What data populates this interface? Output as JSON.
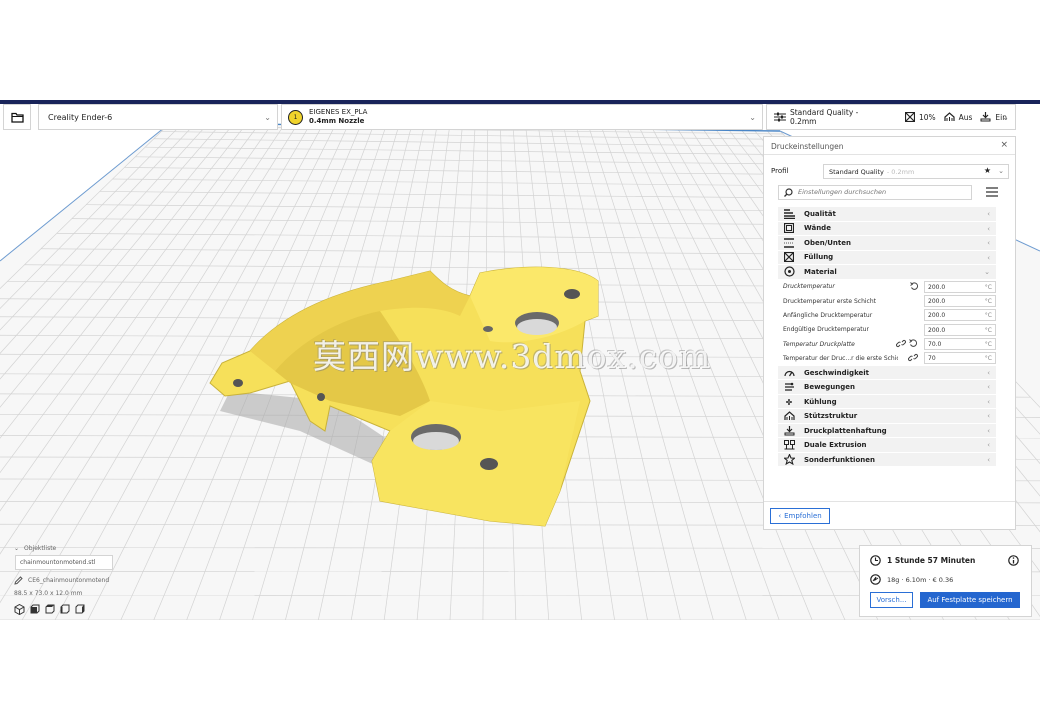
{
  "toolbar": {
    "printer": "Creality Ender-6",
    "material_name": "EIGENES EX_PLA",
    "material_nozzle": "0.4mm Nozzle",
    "quality": "Standard Quality - 0.2mm",
    "infill": "10%",
    "support": "Aus",
    "adhesion": "Ein"
  },
  "panel": {
    "title": "Druckeinstellungen",
    "profile_label": "Profil",
    "profile_value": "Standard Quality",
    "profile_sub": "- 0.2mm",
    "search_placeholder": "Einstellungen durchsuchen",
    "recommended_label": "Empfohlen",
    "categories_top": [
      {
        "label": "Qualität",
        "icon": "quality-icon"
      },
      {
        "label": "Wände",
        "icon": "walls-icon"
      },
      {
        "label": "Oben/Unten",
        "icon": "top-bottom-icon"
      },
      {
        "label": "Füllung",
        "icon": "infill-icon"
      },
      {
        "label": "Material",
        "icon": "material-icon"
      }
    ],
    "material_settings": [
      {
        "label": "Drucktemperatur",
        "value": "200.0",
        "unit": "°C"
      },
      {
        "label": "Drucktemperatur erste Schicht",
        "value": "200.0",
        "unit": "°C"
      },
      {
        "label": "Anfängliche Drucktemperatur",
        "value": "200.0",
        "unit": "°C"
      },
      {
        "label": "Endgültige Drucktemperatur",
        "value": "200.0",
        "unit": "°C"
      },
      {
        "label": "Temperatur Druckplatte",
        "value": "70.0",
        "unit": "°C"
      },
      {
        "label": "Temperatur der Druc...r die erste Schicht",
        "value": "70",
        "unit": "°C"
      }
    ],
    "categories_bottom": [
      {
        "label": "Geschwindigkeit",
        "icon": "speed-icon"
      },
      {
        "label": "Bewegungen",
        "icon": "travel-icon"
      },
      {
        "label": "Kühlung",
        "icon": "cooling-icon"
      },
      {
        "label": "Stützstruktur",
        "icon": "support-icon"
      },
      {
        "label": "Druckplattenhaftung",
        "icon": "adhesion-icon"
      },
      {
        "label": "Duale Extrusion",
        "icon": "dual-extrusion-icon"
      },
      {
        "label": "Sonderfunktionen",
        "icon": "special-modes-icon"
      }
    ]
  },
  "job": {
    "time": "1 Stunde 57 Minuten",
    "stats": "18g · 6.10m · € 0.36",
    "preview_label": "Vorsch...",
    "save_label": "Auf Festplatte speichern"
  },
  "objects": {
    "header": "Objektliste",
    "name_field": "chainmountonmotend.stl",
    "file": "CE6_chainmountonmotend",
    "dims": "88.5 x 73.0 x 12.0 mm"
  },
  "watermark": "莫西网www.3dmox.com",
  "colors": {
    "accent": "#2466cf",
    "model": "#f6e25a",
    "topbar": "#19245a",
    "plate_grid": "#d8d8d8"
  }
}
